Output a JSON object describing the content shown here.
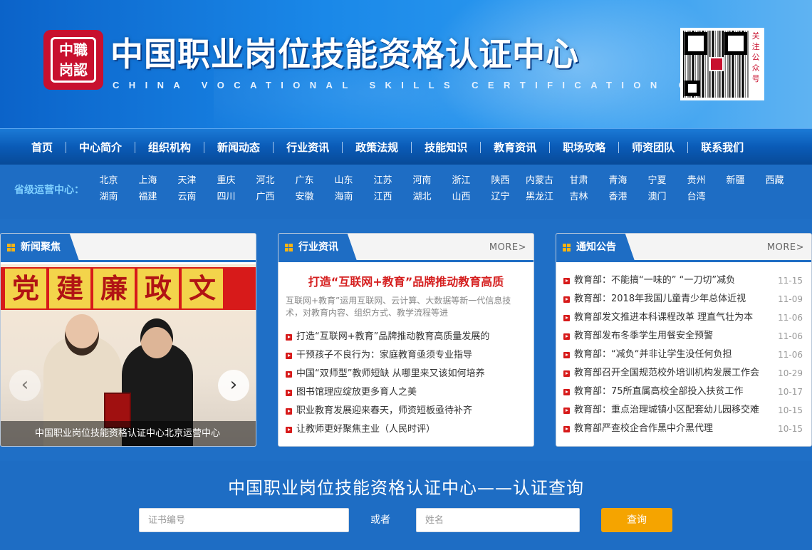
{
  "header": {
    "title": "中国职业岗位技能资格认证中心",
    "subtitle": "CHINA VOCATIONAL SKILLS CERTIFICATION CENTER",
    "seal_text": "中職岗認",
    "qr_caption": "关注公众号"
  },
  "nav": {
    "items": [
      "首页",
      "中心简介",
      "组织机构",
      "新闻动态",
      "行业资讯",
      "政策法规",
      "技能知识",
      "教育资讯",
      "职场攻略",
      "师资团队",
      "联系我们"
    ]
  },
  "provinces": {
    "label": "省级运营中心：",
    "items": [
      "北京",
      "上海",
      "天津",
      "重庆",
      "河北",
      "广东",
      "山东",
      "江苏",
      "河南",
      "浙江",
      "陕西",
      "内蒙古",
      "甘肃",
      "青海",
      "宁夏",
      "贵州",
      "新疆",
      "西藏",
      "湖南",
      "福建",
      "云南",
      "四川",
      "广西",
      "安徽",
      "海南",
      "江西",
      "湖北",
      "山西",
      "辽宁",
      "黑龙江",
      "吉林",
      "香港",
      "澳门",
      "台湾"
    ]
  },
  "news_focus": {
    "title": "新闻聚焦",
    "banner_chars": [
      "党",
      "建",
      "廉",
      "政",
      "文"
    ],
    "caption": "中国职业岗位技能资格认证中心北京运营中心"
  },
  "industry": {
    "title": "行业资讯",
    "more": "MORE>",
    "headline": "打造“互联网+教育”品牌推动教育高质",
    "summary": "互联网+教育”运用互联网、云计算、大数据等新一代信息技术，对教育内容、组织方式、教学流程等进",
    "items": [
      "打造“互联网+教育”品牌推动教育高质量发展的",
      "干预孩子不良行为：家庭教育亟须专业指导",
      "中国“双师型”教师短缺 从哪里来又该如何培养",
      "图书馆理应绽放更多育人之美",
      "职业教育发展迎来春天，师资短板亟待补齐",
      "让教师更好聚焦主业（人民时评）"
    ]
  },
  "notices": {
    "title": "通知公告",
    "more": "MORE>",
    "items": [
      {
        "text": "教育部：不能搞“一味的” “一刀切”减负",
        "date": "11-15"
      },
      {
        "text": "教育部：2018年我国儿童青少年总体近视",
        "date": "11-09"
      },
      {
        "text": "教育部发文推进本科课程改革 理直气壮为本",
        "date": "11-06"
      },
      {
        "text": "教育部发布冬季学生用餐安全预警",
        "date": "11-06"
      },
      {
        "text": "教育部：“减负“并非让学生没任何负担",
        "date": "11-06"
      },
      {
        "text": "教育部召开全国规范校外培训机构发展工作会",
        "date": "10-29"
      },
      {
        "text": "教育部：75所直属高校全部投入扶贫工作",
        "date": "10-17"
      },
      {
        "text": "教育部：重点治理城镇小区配套幼儿园移交难",
        "date": "10-15"
      },
      {
        "text": "教育部严查校企合作黑中介黑代理",
        "date": "10-15"
      }
    ]
  },
  "query": {
    "title": "中国职业岗位技能资格认证中心——认证查询",
    "cert_placeholder": "证书编号",
    "or_label": "或者",
    "name_placeholder": "姓名",
    "button": "查询"
  },
  "colors": {
    "brand_blue": "#1e6dc4",
    "nav_dark": "#084a98",
    "headline_red": "#d51f1f",
    "button_orange": "#f5a400",
    "bullet_red": "#d71a1a"
  }
}
